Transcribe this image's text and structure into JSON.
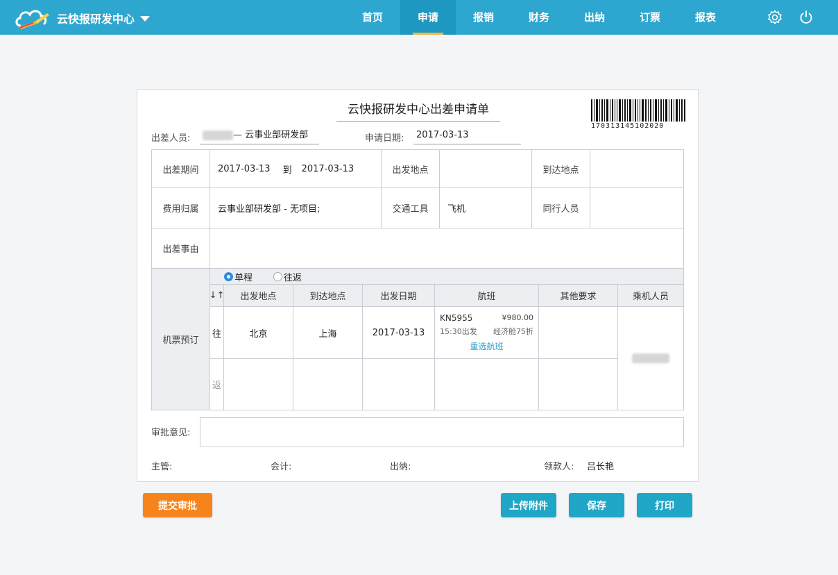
{
  "header": {
    "brand": "云快报研发中心",
    "nav": [
      "首页",
      "申请",
      "报销",
      "财务",
      "出纳",
      "订票",
      "报表"
    ],
    "active_nav": "申请",
    "icons": [
      "settings-icon",
      "power-icon"
    ]
  },
  "form": {
    "title": "云快报研发中心出差申请单",
    "barcode_number": "170313145102020",
    "applicant_label": "出差人员:",
    "applicant_dept": "— 云事业部研发部",
    "apply_date_label": "申请日期:",
    "apply_date": "2017-03-13",
    "period_label": "出差期间",
    "period_start": "2017-03-13",
    "period_to": "到",
    "period_end": "2017-03-13",
    "from_label": "出发地点",
    "from_value": "",
    "to_label": "到达地点",
    "to_value": "",
    "cost_label": "费用归属",
    "cost_value": "云事业部研发部 - 无项目;",
    "transport_label": "交通工具",
    "transport_value": "飞机",
    "companion_label": "同行人员",
    "companion_value": "",
    "reason_label": "出差事由",
    "reason_value": "",
    "ticket_label": "机票预订",
    "trip_options": [
      "单程",
      "往返"
    ],
    "trip_selected": "单程",
    "ticket_headers": [
      "↓↑",
      "出发地点",
      "到达地点",
      "出发日期",
      "航班",
      "其他要求",
      "乘机人员"
    ],
    "outbound": {
      "tag": "往",
      "from": "北京",
      "to": "上海",
      "date": "2017-03-13",
      "flight_no": "KN5955",
      "price": "¥980.00",
      "depart_time": "15:30出发",
      "cabin": "经济舱75折",
      "reselect": "重选航班"
    },
    "return": {
      "tag": "返"
    },
    "approval_label": "审批意见:",
    "approval_value": "",
    "signatures": {
      "supervisor": "主管:",
      "accountant": "会计:",
      "cashier": "出纳:",
      "payee_label": "领款人:",
      "payee_name": "吕长艳"
    }
  },
  "actions": {
    "submit": "提交审批",
    "upload": "上传附件",
    "save": "保存",
    "print": "打印"
  },
  "colors": {
    "topbar": "#2da7cf",
    "active_tab_underline": "#f3b640",
    "submit_button": "#f7841b",
    "action_button": "#20a6c6",
    "link": "#2a9fc6"
  }
}
